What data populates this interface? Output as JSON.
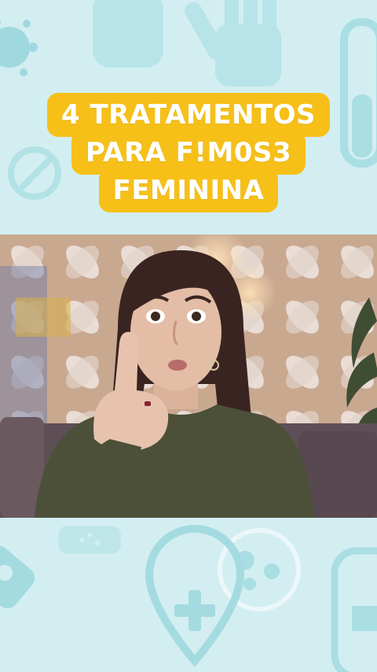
{
  "title": {
    "lines": [
      "4 TRATAMENTOS",
      "PARA F!M0S3",
      "FEMININA"
    ]
  },
  "background": {
    "color": "#d3eef1",
    "icon_color": "#a9dee3",
    "icons": [
      "virus-icon",
      "glove-icon",
      "test-tube-icon",
      "pill-icon",
      "bandage-icon",
      "petri-dish-icon",
      "medical-location-pin-icon",
      "bottle-icon"
    ]
  },
  "video": {
    "subject": "woman-raising-index-finger",
    "colors": {
      "wall": "#c7a58d",
      "shirt": "#4d5039",
      "hair": "#3a2421",
      "skin": "#e3bda6",
      "sofa": "#5d4f55"
    }
  },
  "accent": "#f6c018"
}
